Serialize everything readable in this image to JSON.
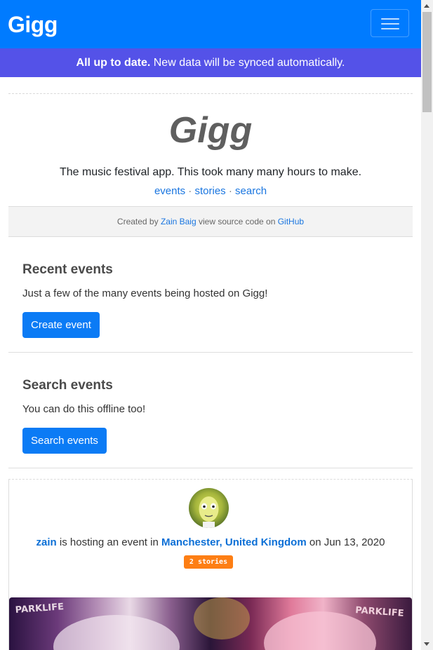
{
  "navbar": {
    "brand": "Gigg",
    "menu_icon": "hamburger-menu-icon"
  },
  "sync_banner": {
    "strong": "All up to date.",
    "text": " New data will be synced automatically."
  },
  "hero": {
    "title": "Gigg",
    "subtitle": "The music festival app. This took many many hours to make.",
    "links": [
      "events",
      "stories",
      "search"
    ],
    "separator": " · "
  },
  "credit": {
    "prefix": "Created by ",
    "author": "Zain Baig",
    "middle": " view source code on ",
    "repo": "GitHub"
  },
  "sections": {
    "recent": {
      "title": "Recent events",
      "text": "Just a few of the many events being hosted on Gigg!",
      "button": "Create event"
    },
    "search": {
      "title": "Search events",
      "text": "You can do this offline too!",
      "button": "Search events"
    }
  },
  "event_card": {
    "user": "zain",
    "text1": " is hosting an event in ",
    "location": "Manchester, United Kingdom",
    "text2": " on Jun 13, 2020",
    "badge": "2 stories",
    "image_text_left": "PARKLIFE",
    "image_text_right": "PARKLIFE"
  },
  "colors": {
    "primary": "#007bff",
    "banner": "#5452e8",
    "badge": "#fd7e14"
  }
}
